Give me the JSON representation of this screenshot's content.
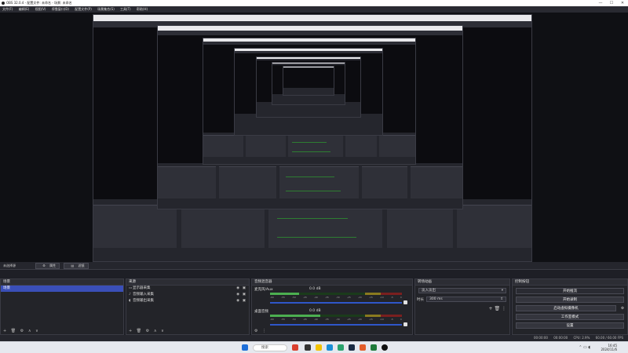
{
  "window": {
    "title": "OBS 32.0.4 - 配置文件: 未命名 - 场景: 未命名",
    "min": "—",
    "max": "☐",
    "close": "✕"
  },
  "menu": [
    "文件(F)",
    "编辑(E)",
    "视图(V)",
    "停靠窗口(D)",
    "配置文件(P)",
    "场景集合(S)",
    "工具(T)",
    "帮助(H)"
  ],
  "source_bar": {
    "no_source": "未选择源",
    "props": "属性",
    "filters": "滤镜",
    "properties_icon": "gear-icon",
    "filters_icon": "filter-icon"
  },
  "scenes": {
    "header": "场景",
    "items": [
      "场景"
    ],
    "footer": [
      "+",
      "🗑",
      "⚙",
      "∧",
      "∨"
    ]
  },
  "sources": {
    "header": "来源",
    "items": [
      {
        "icon": "monitor-icon",
        "label": "显示器采集"
      },
      {
        "icon": "mic-icon",
        "label": "音频输入采集"
      },
      {
        "icon": "speaker-icon",
        "label": "音频输出采集"
      }
    ],
    "footer": [
      "+",
      "🗑",
      "⚙",
      "∧",
      "∨"
    ]
  },
  "mixer": {
    "header": "音频混音器",
    "channels": [
      {
        "name": "麦克风/Aux",
        "value": "0.0 dB",
        "level": 0.22
      },
      {
        "name": "桌面音频",
        "value": "0.0 dB",
        "level": 0.38
      }
    ],
    "ticks": [
      "-60",
      "-55",
      "-50",
      "-45",
      "-40",
      "-35",
      "-30",
      "-25",
      "-20",
      "-15",
      "-10",
      "-5",
      "0"
    ],
    "footer": [
      "⚙",
      "⋮"
    ]
  },
  "transitions": {
    "header": "转场动画",
    "type": "淡入淡出",
    "duration_label": "时长",
    "duration": "300 ms",
    "footer": [
      "+",
      "🗑",
      "⋮"
    ]
  },
  "controls": {
    "header": "控制按钮",
    "buttons": [
      "开始推流",
      "开始录制",
      "启动虚拟摄像机",
      "工作室模式",
      "设置"
    ],
    "gear": "⚙"
  },
  "status": {
    "stats": "00:00:00",
    "rec": "00:00:00",
    "cpu": "CPU: 2.9%",
    "fps": "60.00 / 60.00 FPS"
  },
  "taskbar": {
    "search": "搜索",
    "time": "16:45",
    "date": "2024/11/6"
  },
  "colors": {
    "accent": "#3a4fb8",
    "meter_green": "#4caf50",
    "meter_yellow": "#8a7a1f",
    "meter_red": "#7a1f1f"
  }
}
